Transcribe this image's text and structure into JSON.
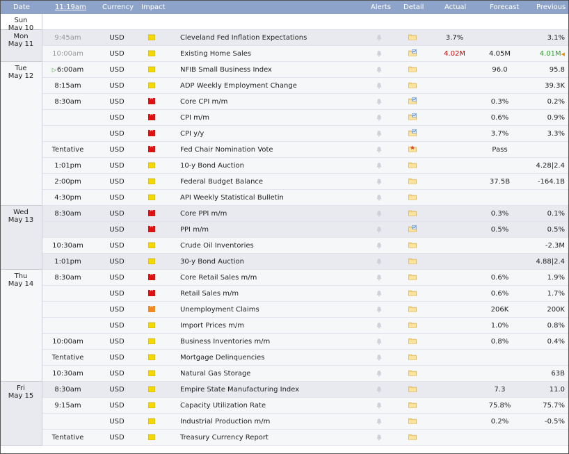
{
  "header": {
    "date": "Date",
    "time": "11:19am",
    "currency": "Currency",
    "impact": "Impact",
    "alerts": "Alerts",
    "detail": "Detail",
    "actual": "Actual",
    "forecast": "Forecast",
    "previous": "Previous"
  },
  "colors": {
    "header_bg": "#8ea3c9",
    "impact_high": "#e01010",
    "impact_medium": "#f08a20",
    "impact_low": "#f5d800",
    "actual_worse": "#cc0000",
    "actual_better": "#2a9d2a"
  },
  "days": [
    {
      "dow": "Sun",
      "date": "May 10"
    },
    {
      "dow": "Mon",
      "date": "May 11"
    },
    {
      "dow": "Tue",
      "date": "May 12"
    },
    {
      "dow": "Wed",
      "date": "May 13"
    },
    {
      "dow": "Thu",
      "date": "May 14"
    },
    {
      "dow": "Fri",
      "date": "May 15"
    }
  ],
  "events": [
    {
      "time": "9:45am",
      "currency": "USD",
      "impact": "low",
      "event": "Cleveland Fed Inflation Expectations",
      "detail_icon": "folder-icon",
      "actual": "3.7%",
      "forecast": "",
      "previous": "3.1%"
    },
    {
      "time": "10:00am",
      "currency": "USD",
      "impact": "low",
      "event": "Existing Home Sales",
      "detail_icon": "folder-chart-icon",
      "actual": "4.02M",
      "forecast": "4.05M",
      "previous": "4.01M"
    },
    {
      "time": "6:00am",
      "currency": "USD",
      "impact": "low",
      "event": "NFIB Small Business Index",
      "detail_icon": "folder-icon",
      "actual": "",
      "forecast": "96.0",
      "previous": "95.8"
    },
    {
      "time": "8:15am",
      "currency": "USD",
      "impact": "low",
      "event": "ADP Weekly Employment Change",
      "detail_icon": "folder-icon",
      "actual": "",
      "forecast": "",
      "previous": "39.3K"
    },
    {
      "time": "8:30am",
      "currency": "USD",
      "impact": "high",
      "event": "Core CPI m/m",
      "detail_icon": "folder-chart-icon",
      "actual": "",
      "forecast": "0.3%",
      "previous": "0.2%"
    },
    {
      "time": "",
      "currency": "USD",
      "impact": "high",
      "event": "CPI m/m",
      "detail_icon": "folder-chart-icon",
      "actual": "",
      "forecast": "0.6%",
      "previous": "0.9%"
    },
    {
      "time": "",
      "currency": "USD",
      "impact": "high",
      "event": "CPI y/y",
      "detail_icon": "folder-chart-icon",
      "actual": "",
      "forecast": "3.7%",
      "previous": "3.3%"
    },
    {
      "time": "Tentative",
      "currency": "USD",
      "impact": "high",
      "event": "Fed Chair Nomination Vote",
      "detail_icon": "folder-star-icon",
      "actual": "",
      "forecast": "Pass",
      "previous": ""
    },
    {
      "time": "1:01pm",
      "currency": "USD",
      "impact": "low",
      "event": "10-y Bond Auction",
      "detail_icon": "folder-icon",
      "actual": "",
      "forecast": "",
      "previous": "4.28|2.4"
    },
    {
      "time": "2:00pm",
      "currency": "USD",
      "impact": "low",
      "event": "Federal Budget Balance",
      "detail_icon": "folder-icon",
      "actual": "",
      "forecast": "37.5B",
      "previous": "-164.1B"
    },
    {
      "time": "4:30pm",
      "currency": "USD",
      "impact": "low",
      "event": "API Weekly Statistical Bulletin",
      "detail_icon": "folder-icon",
      "actual": "",
      "forecast": "",
      "previous": ""
    },
    {
      "time": "8:30am",
      "currency": "USD",
      "impact": "high",
      "event": "Core PPI m/m",
      "detail_icon": "folder-icon",
      "actual": "",
      "forecast": "0.3%",
      "previous": "0.1%"
    },
    {
      "time": "",
      "currency": "USD",
      "impact": "high",
      "event": "PPI m/m",
      "detail_icon": "folder-chart-icon",
      "actual": "",
      "forecast": "0.5%",
      "previous": "0.5%"
    },
    {
      "time": "10:30am",
      "currency": "USD",
      "impact": "low",
      "event": "Crude Oil Inventories",
      "detail_icon": "folder-icon",
      "actual": "",
      "forecast": "",
      "previous": "-2.3M"
    },
    {
      "time": "1:01pm",
      "currency": "USD",
      "impact": "low",
      "event": "30-y Bond Auction",
      "detail_icon": "folder-icon",
      "actual": "",
      "forecast": "",
      "previous": "4.88|2.4"
    },
    {
      "time": "8:30am",
      "currency": "USD",
      "impact": "high",
      "event": "Core Retail Sales m/m",
      "detail_icon": "folder-icon",
      "actual": "",
      "forecast": "0.6%",
      "previous": "1.9%"
    },
    {
      "time": "",
      "currency": "USD",
      "impact": "high",
      "event": "Retail Sales m/m",
      "detail_icon": "folder-icon",
      "actual": "",
      "forecast": "0.6%",
      "previous": "1.7%"
    },
    {
      "time": "",
      "currency": "USD",
      "impact": "medium",
      "event": "Unemployment Claims",
      "detail_icon": "folder-icon",
      "actual": "",
      "forecast": "206K",
      "previous": "200K"
    },
    {
      "time": "",
      "currency": "USD",
      "impact": "low",
      "event": "Import Prices m/m",
      "detail_icon": "folder-icon",
      "actual": "",
      "forecast": "1.0%",
      "previous": "0.8%"
    },
    {
      "time": "10:00am",
      "currency": "USD",
      "impact": "low",
      "event": "Business Inventories m/m",
      "detail_icon": "folder-icon",
      "actual": "",
      "forecast": "0.8%",
      "previous": "0.4%"
    },
    {
      "time": "Tentative",
      "currency": "USD",
      "impact": "low",
      "event": "Mortgage Delinquencies",
      "detail_icon": "folder-icon",
      "actual": "",
      "forecast": "",
      "previous": ""
    },
    {
      "time": "10:30am",
      "currency": "USD",
      "impact": "low",
      "event": "Natural Gas Storage",
      "detail_icon": "folder-icon",
      "actual": "",
      "forecast": "",
      "previous": "63B"
    },
    {
      "time": "8:30am",
      "currency": "USD",
      "impact": "low",
      "event": "Empire State Manufacturing Index",
      "detail_icon": "folder-icon",
      "actual": "",
      "forecast": "7.3",
      "previous": "11.0"
    },
    {
      "time": "9:15am",
      "currency": "USD",
      "impact": "low",
      "event": "Capacity Utilization Rate",
      "detail_icon": "folder-icon",
      "actual": "",
      "forecast": "75.8%",
      "previous": "75.7%"
    },
    {
      "time": "",
      "currency": "USD",
      "impact": "low",
      "event": "Industrial Production m/m",
      "detail_icon": "folder-icon",
      "actual": "",
      "forecast": "0.2%",
      "previous": "-0.5%"
    },
    {
      "time": "Tentative",
      "currency": "USD",
      "impact": "low",
      "event": "Treasury Currency Report",
      "detail_icon": "folder-icon",
      "actual": "",
      "forecast": "",
      "previous": ""
    }
  ]
}
